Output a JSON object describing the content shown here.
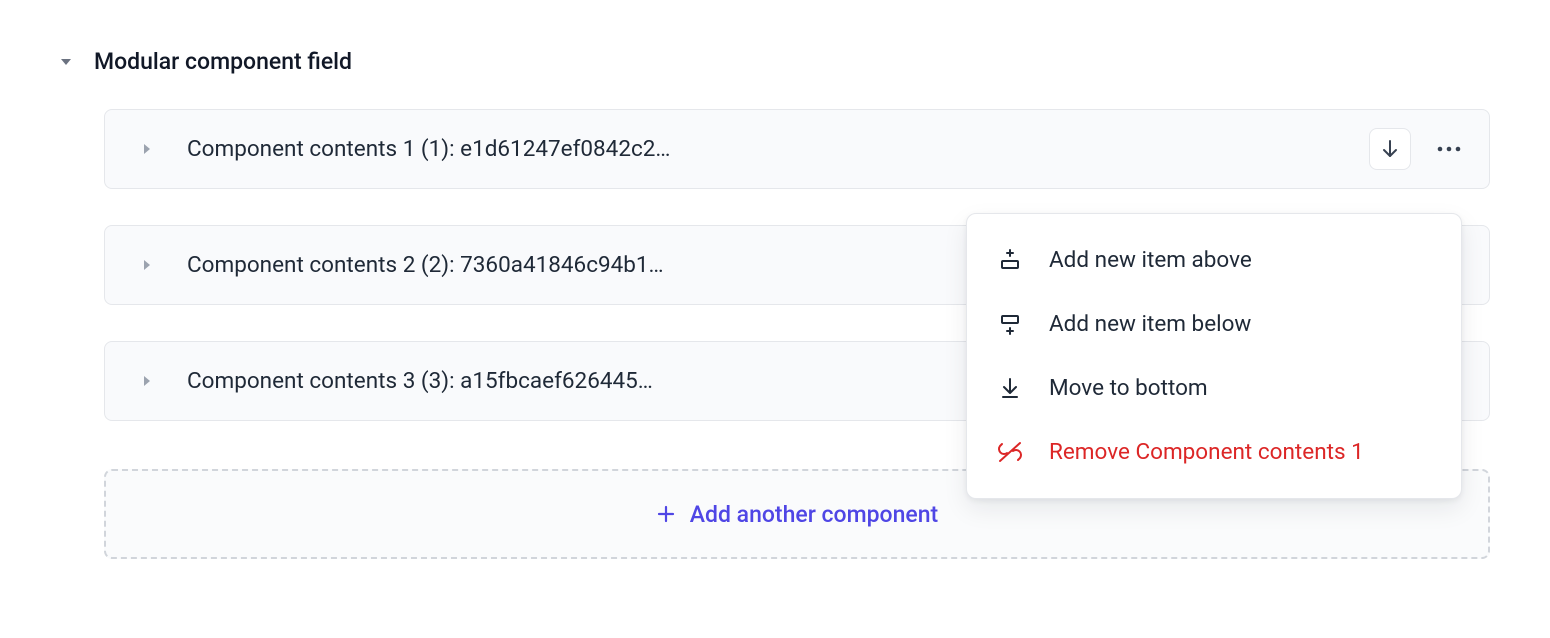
{
  "field_title": "Modular component field",
  "components": [
    {
      "label": "Component contents 1 (1): e1d61247ef0842c2…"
    },
    {
      "label": "Component contents 2 (2): 7360a41846c94b1…"
    },
    {
      "label": "Component contents 3 (3): a15fbcaef626445…"
    }
  ],
  "add_button_label": "Add another component",
  "menu": {
    "add_above": "Add new item above",
    "add_below": "Add new item below",
    "move_bottom": "Move to bottom",
    "remove": "Remove Component contents 1"
  }
}
